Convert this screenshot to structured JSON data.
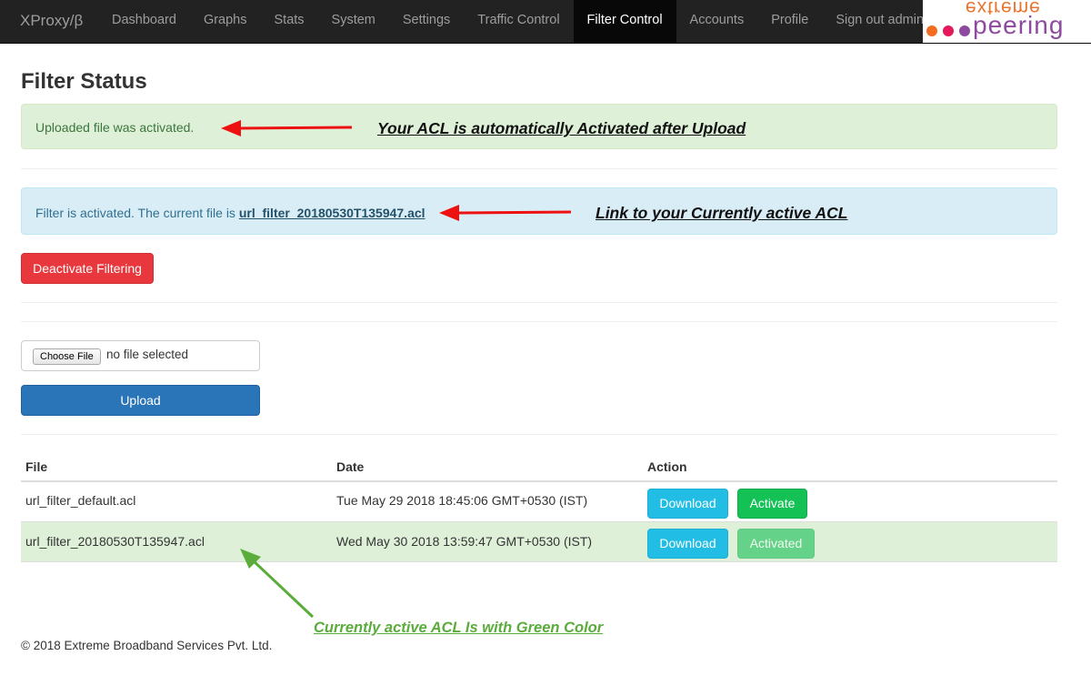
{
  "navbar": {
    "brand": "XProxy/β",
    "items": [
      {
        "label": "Dashboard",
        "active": false
      },
      {
        "label": "Graphs",
        "active": false
      },
      {
        "label": "Stats",
        "active": false
      },
      {
        "label": "System",
        "active": false
      },
      {
        "label": "Settings",
        "active": false
      },
      {
        "label": "Traffic Control",
        "active": false
      },
      {
        "label": "Filter Control",
        "active": true
      },
      {
        "label": "Accounts",
        "active": false
      },
      {
        "label": "Profile",
        "active": false
      },
      {
        "label": "Sign out admin",
        "active": false
      }
    ],
    "logo": {
      "top": "extreme",
      "main": "peering",
      "dot_colors": [
        "#f26d21",
        "#e4185b",
        "#8e4aa0"
      ]
    }
  },
  "page_title": "Filter Status",
  "alert_success": {
    "text": "Uploaded file was activated."
  },
  "alert_info": {
    "prefix": "Filter is activated. The current file is ",
    "link": "url_filter_20180530T135947.acl"
  },
  "annotations": {
    "note1": "Your ACL is automatically Activated after Upload",
    "note2": "Link to your Currently active ACL",
    "note3": "Currently active ACL Is with Green Color",
    "red_arrow_color": "#ee1111",
    "green_arrow_color": "#5aac3b"
  },
  "deactivate_button": "Deactivate Filtering",
  "file_input": {
    "button": "Choose File",
    "status": "no file selected"
  },
  "upload_button": "Upload",
  "table": {
    "headers": {
      "file": "File",
      "date": "Date",
      "action": "Action"
    },
    "rows": [
      {
        "file": "url_filter_default.acl",
        "date": "Tue May 29 2018 18:45:06 GMT+0530 (IST)",
        "download": "Download",
        "activate": "Activate",
        "active": false
      },
      {
        "file": "url_filter_20180530T135947.acl",
        "date": "Wed May 30 2018 13:59:47 GMT+0530 (IST)",
        "download": "Download",
        "activate": "Activated",
        "active": true
      }
    ]
  },
  "footer": "© 2018 Extreme Broadband Services Pvt. Ltd."
}
